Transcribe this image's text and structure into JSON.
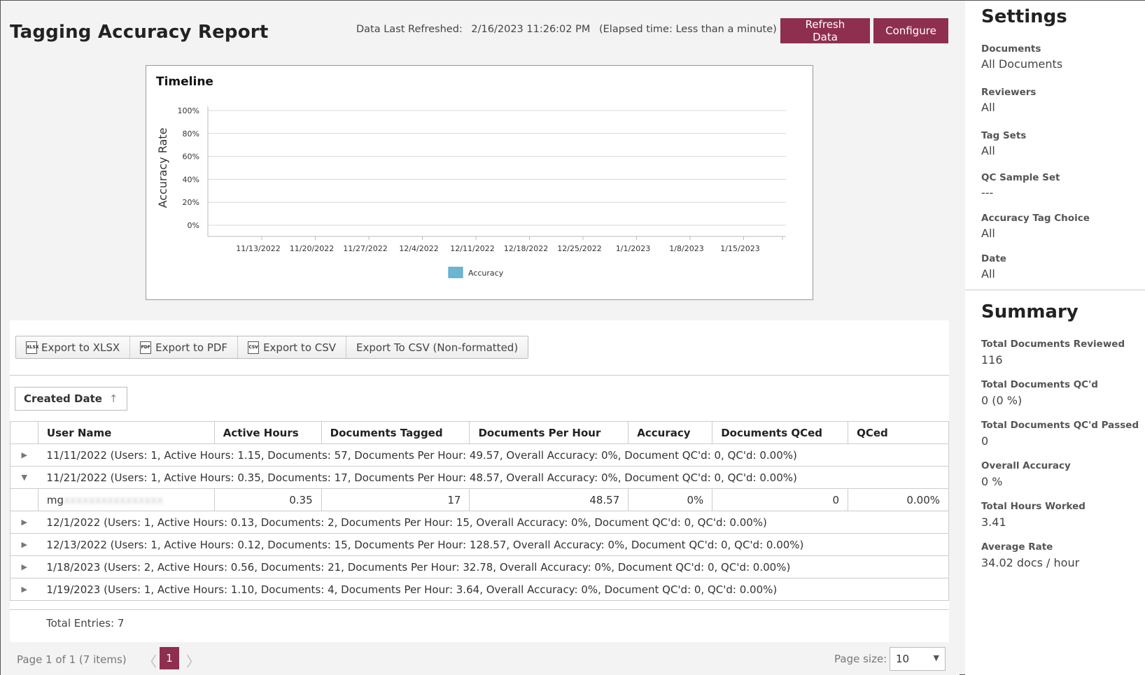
{
  "header": {
    "title": "Tagging Accuracy Report",
    "refreshed_label": "Data Last Refreshed:",
    "refreshed_value": "2/16/2023 11:26:02 PM",
    "elapsed": "(Elapsed time: Less than a minute)",
    "refresh_button": "Refresh Data",
    "configure_button": "Configure"
  },
  "chart_data": {
    "type": "line",
    "title": "Timeline",
    "ylabel": "Accuracy Rate",
    "xlabel": "",
    "ylim": [
      0,
      100
    ],
    "y_ticks": [
      "100%",
      "80%",
      "60%",
      "40%",
      "20%",
      "0%"
    ],
    "categories": [
      "11/13/2022",
      "11/20/2022",
      "11/27/2022",
      "12/4/2022",
      "12/11/2022",
      "12/18/2022",
      "12/25/2022",
      "1/1/2023",
      "1/8/2023",
      "1/15/2023"
    ],
    "series": [
      {
        "name": "Accuracy",
        "values": [
          0,
          0,
          0,
          0,
          0,
          0,
          0,
          0,
          0,
          0
        ],
        "color": "#6cb5d3"
      }
    ],
    "grid": true,
    "legend": "bottom"
  },
  "toolbar": {
    "export_xlsx": "Export to XLSX",
    "export_pdf": "Export to PDF",
    "export_csv": "Export to CSV",
    "export_csv_raw": "Export To CSV (Non-formatted)",
    "icon_xlsx": "XLSX",
    "icon_pdf": "PDF",
    "icon_csv": "CSV"
  },
  "grouping": {
    "label": "Created Date",
    "arrow": "↑"
  },
  "grid": {
    "columns": [
      "User Name",
      "Active Hours",
      "Documents Tagged",
      "Documents Per Hour",
      "Accuracy",
      "Documents QCed",
      "QCed"
    ],
    "groups": [
      {
        "text": "11/11/2022 (Users: 1, Active Hours: 1.15, Documents: 57, Documents Per Hour: 49.57, Overall Accuracy: 0%, Document QC'd: 0, QC'd: 0.00%)",
        "expander": "▶"
      },
      {
        "text": "11/21/2022 (Users: 1, Active Hours: 0.35, Documents: 17, Documents Per Hour: 48.57, Overall Accuracy: 0%, Document QC'd: 0, QC'd: 0.00%)",
        "expander": "▼"
      },
      {
        "text": "12/1/2022 (Users: 1, Active Hours: 0.13, Documents: 2, Documents Per Hour: 15, Overall Accuracy: 0%, Document QC'd: 0, QC'd: 0.00%)",
        "expander": "▶"
      },
      {
        "text": "12/13/2022 (Users: 1, Active Hours: 0.12, Documents: 15, Documents Per Hour: 128.57, Overall Accuracy: 0%, Document QC'd: 0, QC'd: 0.00%)",
        "expander": "▶"
      },
      {
        "text": "1/18/2023 (Users: 2, Active Hours: 0.56, Documents: 21, Documents Per Hour: 32.78, Overall Accuracy: 0%, Document QC'd: 0, QC'd: 0.00%)",
        "expander": "▶"
      },
      {
        "text": "1/19/2023 (Users: 1, Active Hours: 1.10, Documents: 4, Documents Per Hour: 3.64, Overall Accuracy: 0%, Document QC'd: 0, QC'd: 0.00%)",
        "expander": "▶"
      }
    ],
    "detail": {
      "user_name": "mg",
      "user_name_hidden": "xxxxxxxxxxxxxxxx",
      "active_hours": "0.35",
      "documents_tagged": "17",
      "documents_per_hour": "48.57",
      "accuracy": "0%",
      "documents_qced": "0",
      "qced": "0.00%"
    },
    "total_entries": "Total Entries: 7"
  },
  "pager": {
    "info": "Page 1 of 1 (7 items)",
    "current": "1",
    "prev": "〈",
    "next": "〉",
    "page_size_label": "Page size:",
    "page_size": "10",
    "caret": "▼"
  },
  "settings": {
    "title": "Settings",
    "items": [
      {
        "label": "Documents",
        "value": "All Documents"
      },
      {
        "label": "Reviewers",
        "value": "All"
      },
      {
        "label": "Tag Sets",
        "value": "All"
      },
      {
        "label": "QC Sample Set",
        "value": "---"
      },
      {
        "label": "Accuracy Tag Choice",
        "value": "All"
      },
      {
        "label": "Date",
        "value": "All"
      }
    ]
  },
  "summary": {
    "title": "Summary",
    "items": [
      {
        "label": "Total Documents Reviewed",
        "value": "116"
      },
      {
        "label": "Total Documents QC'd",
        "value": "0 (0 %)"
      },
      {
        "label": "Total Documents QC'd Passed",
        "value": "0"
      },
      {
        "label": "Overall Accuracy",
        "value": "0 %"
      },
      {
        "label": "Total Hours Worked",
        "value": "3.41"
      },
      {
        "label": "Average Rate",
        "value": "34.02 docs / hour"
      }
    ]
  }
}
